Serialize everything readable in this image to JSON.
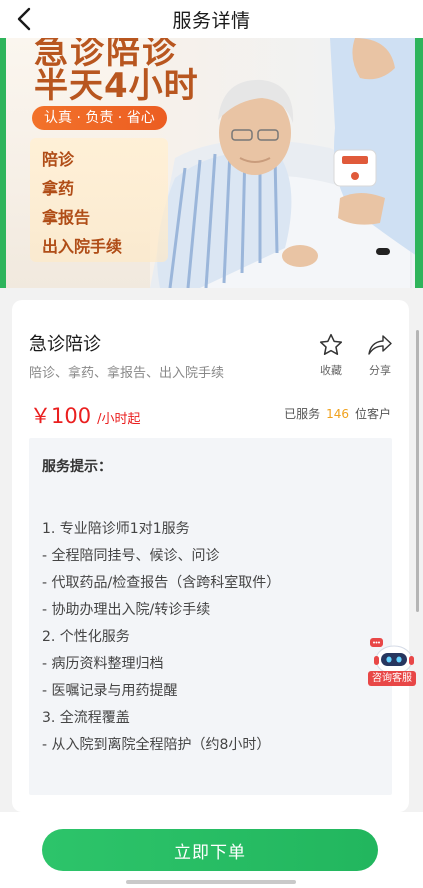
{
  "nav": {
    "title": "服务详情"
  },
  "banner": {
    "headline_top": "急诊陪诊",
    "headline_main": "半天4小时",
    "pill": "认真 · 负责 · 省心",
    "features": [
      "陪诊",
      "拿药",
      "拿报告",
      "出入院手续"
    ],
    "colors": {
      "headline": "#b8561f",
      "pill": "#ef6525",
      "edge": "#2eb45b"
    }
  },
  "service": {
    "name": "急诊陪诊",
    "subtitle": "陪诊、拿药、拿报告、出入院手续",
    "favorite_label": "收藏",
    "share_label": "分享",
    "price_amount": "￥100",
    "price_unit": "/小时起",
    "served_prefix": "已服务",
    "served_count": "146",
    "served_suffix": "位客户"
  },
  "tips": {
    "title": "服务提示：",
    "lines": [
      "1. 专业陪诊师1对1服务",
      "- 全程陪同挂号、候诊、问诊",
      "- 代取药品/检查报告（含跨科室取件）",
      "- 协助办理出入院/转诊手续",
      "2. 个性化服务",
      "- 病历资料整理归档",
      "- 医嘱记录与用药提醒",
      "3. 全流程覆盖",
      "- 从入院到离院全程陪护（约8小时）"
    ]
  },
  "chat": {
    "label": "咨询客服"
  },
  "bottom": {
    "order_label": "立即下单"
  },
  "icons": [
    "back-arrow-icon",
    "star-icon",
    "share-arrow-icon",
    "robot-icon"
  ],
  "colors": {
    "accent_green": "#22b65e",
    "price_red": "#ea1f1f",
    "count_orange": "#f0a21e"
  }
}
